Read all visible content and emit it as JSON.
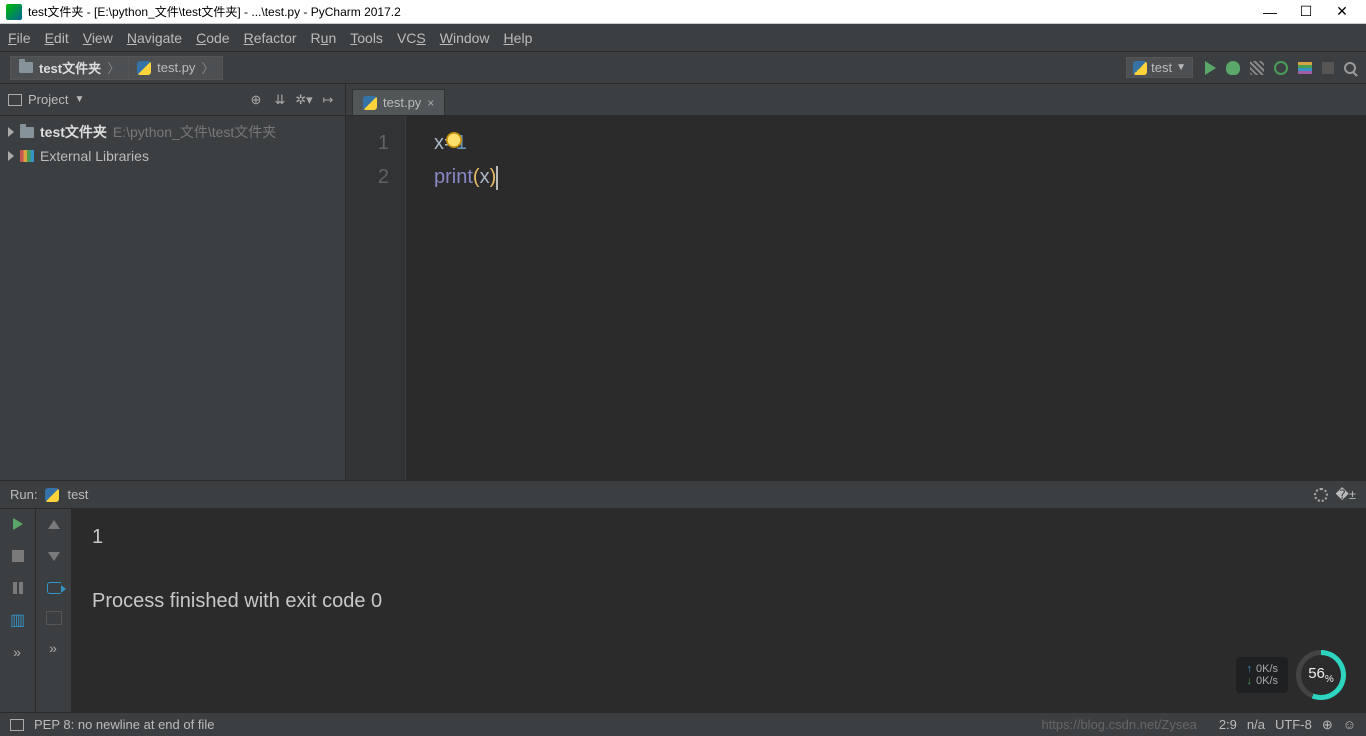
{
  "titlebar": {
    "text": "test文件夹 - [E:\\python_文件\\test文件夹] - ...\\test.py - PyCharm 2017.2"
  },
  "menu": {
    "file": "File",
    "edit": "Edit",
    "view": "View",
    "navigate": "Navigate",
    "code": "Code",
    "refactor": "Refactor",
    "run": "Run",
    "tools": "Tools",
    "vcs": "VCS",
    "window": "Window",
    "help": "Help"
  },
  "breadcrumb": {
    "root": "test文件夹",
    "file": "test.py"
  },
  "run_config": {
    "selected": "test"
  },
  "sidebar": {
    "title": "Project",
    "project_name": "test文件夹",
    "project_path": "E:\\python_文件\\test文件夹",
    "external": "External Libraries"
  },
  "editor": {
    "tab": "test.py",
    "lines": {
      "l1": "1",
      "l2": "2"
    },
    "code": {
      "l1_var": "x",
      "l1_op": "=",
      "l1_num": "1",
      "l2_fn": "print",
      "l2_lp": "(",
      "l2_arg": "x",
      "l2_rp": ")"
    }
  },
  "run_panel": {
    "label": "Run:",
    "config": "test",
    "output_1": "1",
    "exit_msg": "Process finished with exit code 0"
  },
  "net": {
    "up": "0K/s",
    "down": "0K/s",
    "pct": "56",
    "pct_suffix": "%"
  },
  "status": {
    "message": "PEP 8: no newline at end of file",
    "watermark": "https://blog.csdn.net/Zysea",
    "pos": "2:9",
    "mode": "n/a",
    "encoding": "UTF-8",
    "lock": "⊕"
  }
}
